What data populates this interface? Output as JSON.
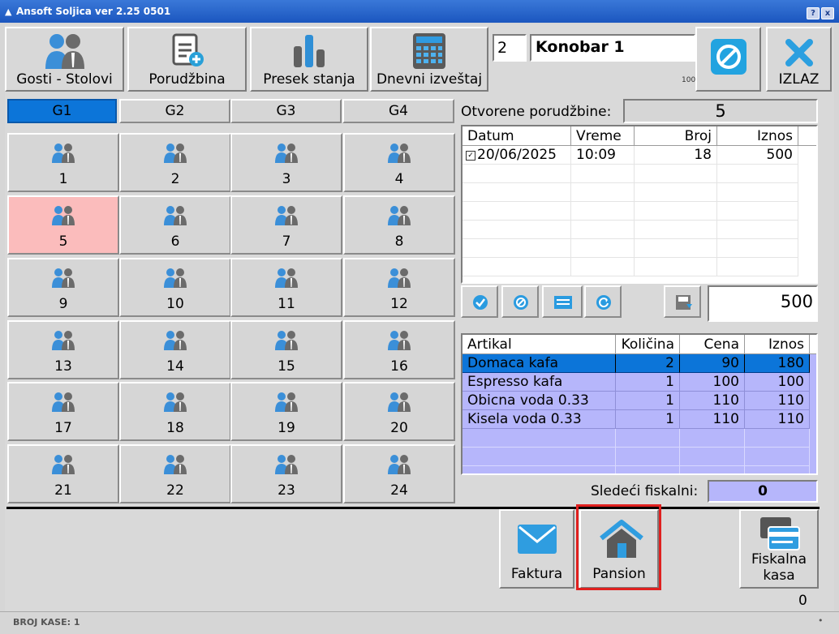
{
  "window": {
    "title": "Ansoft Soljica ver 2.25 0501",
    "help_btn": "?",
    "close_btn": "x"
  },
  "toolbar": {
    "buttons": [
      {
        "label": "Gosti - Stolovi",
        "icon": "people-icon"
      },
      {
        "label": "Porudžbina",
        "icon": "add-order-icon"
      },
      {
        "label": "Presek stanja",
        "icon": "bar-chart-icon"
      },
      {
        "label": "Dnevni izveštaj",
        "icon": "calculator-icon"
      }
    ],
    "waiter_id": "2",
    "waiter_name": "Konobar 1",
    "small_value": "100",
    "exit_label": "IZLAZ"
  },
  "tabs": [
    {
      "label": "G1",
      "active": true
    },
    {
      "label": "G2",
      "active": false
    },
    {
      "label": "G3",
      "active": false
    },
    {
      "label": "G4",
      "active": false
    }
  ],
  "tables": [
    {
      "num": "1",
      "busy": false
    },
    {
      "num": "2",
      "busy": false
    },
    {
      "num": "3",
      "busy": false
    },
    {
      "num": "4",
      "busy": false
    },
    {
      "num": "5",
      "busy": true
    },
    {
      "num": "6",
      "busy": false
    },
    {
      "num": "7",
      "busy": false
    },
    {
      "num": "8",
      "busy": false
    },
    {
      "num": "9",
      "busy": false
    },
    {
      "num": "10",
      "busy": false
    },
    {
      "num": "11",
      "busy": false
    },
    {
      "num": "12",
      "busy": false
    },
    {
      "num": "13",
      "busy": false
    },
    {
      "num": "14",
      "busy": false
    },
    {
      "num": "15",
      "busy": false
    },
    {
      "num": "16",
      "busy": false
    },
    {
      "num": "17",
      "busy": false
    },
    {
      "num": "18",
      "busy": false
    },
    {
      "num": "19",
      "busy": false
    },
    {
      "num": "20",
      "busy": false
    },
    {
      "num": "21",
      "busy": false
    },
    {
      "num": "22",
      "busy": false
    },
    {
      "num": "23",
      "busy": false
    },
    {
      "num": "24",
      "busy": false
    }
  ],
  "orders": {
    "label": "Otvorene porudžbine:",
    "count": "5",
    "columns": [
      "Datum",
      "Vreme",
      "Broj",
      "Iznos"
    ],
    "rows": [
      {
        "datum": "20/06/2025",
        "vreme": "10:09",
        "broj": "18",
        "iznos": "500",
        "checked": true
      }
    ],
    "total": "500"
  },
  "items": {
    "columns": [
      "Artikal",
      "Količina",
      "Cena",
      "Iznos"
    ],
    "rows": [
      {
        "artikal": "Domaca kafa",
        "kolicina": "2",
        "cena": "90",
        "iznos": "180",
        "selected": true
      },
      {
        "artikal": "Espresso kafa",
        "kolicina": "1",
        "cena": "100",
        "iznos": "100",
        "selected": false
      },
      {
        "artikal": "Obicna voda 0.33",
        "kolicina": "1",
        "cena": "110",
        "iznos": "110",
        "selected": false
      },
      {
        "artikal": "Kisela voda 0.33",
        "kolicina": "1",
        "cena": "110",
        "iznos": "110",
        "selected": false
      }
    ]
  },
  "fiscal": {
    "label": "Sledeći fiskalni:",
    "value": "0"
  },
  "bottom": {
    "faktura": "Faktura",
    "pansion": "Pansion",
    "fiskalna_line1": "Fiskalna",
    "fiskalna_line2": "kasa",
    "counter": "0"
  },
  "status": {
    "text": "BROJ KASE: 1",
    "dot": "•"
  },
  "colors": {
    "accent": "#0c75d9",
    "busy": "#fbbcbc",
    "row_bg": "#b6b6fb",
    "highlight_border": "#e0201f"
  }
}
